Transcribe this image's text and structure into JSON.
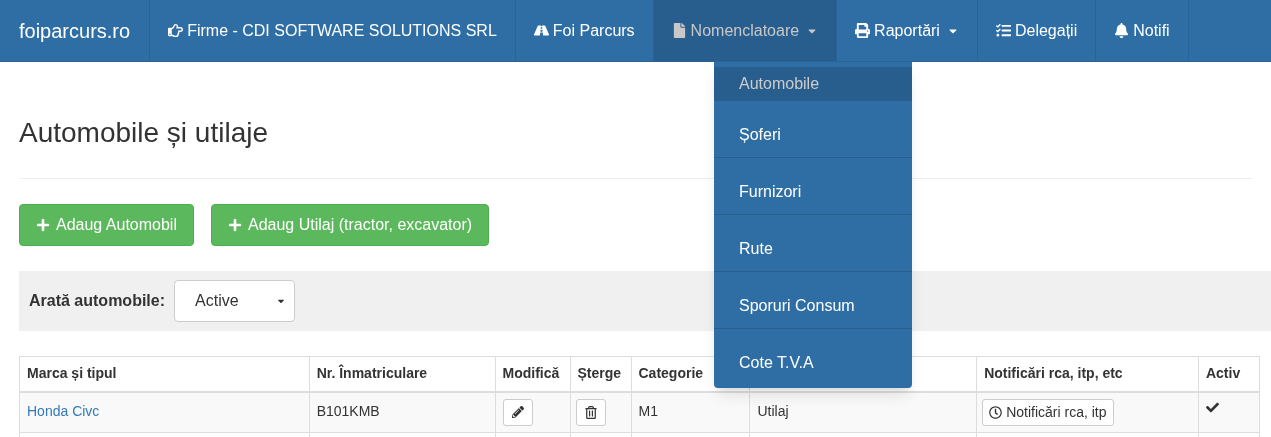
{
  "navbar": {
    "brand": "foiparcurs.ro",
    "items": [
      {
        "label": "Firme - CDI SOFTWARE SOLUTIONS SRL",
        "caret": false,
        "open": false
      },
      {
        "label": "Foi Parcurs",
        "caret": false,
        "open": false
      },
      {
        "label": "Nomenclatoare",
        "caret": true,
        "open": true
      },
      {
        "label": "Raportări",
        "caret": true,
        "open": false
      },
      {
        "label": "Delegații",
        "caret": false,
        "open": false
      },
      {
        "label": "Notifi",
        "caret": false,
        "open": false
      }
    ]
  },
  "dropdown": {
    "items": [
      {
        "label": "Automobile",
        "selected": true
      },
      {
        "label": "Șoferi",
        "selected": false
      },
      {
        "label": "Furnizori",
        "selected": false
      },
      {
        "label": "Rute",
        "selected": false
      },
      {
        "label": "Sporuri Consum",
        "selected": false
      },
      {
        "label": "Cote T.V.A",
        "selected": false
      }
    ]
  },
  "page_title": "Automobile și utilaje",
  "add_buttons": [
    "Adaug Automobil",
    "Adaug Utilaj (tractor, excavator)"
  ],
  "filter": {
    "label": "Arată automobile:",
    "value": "Active"
  },
  "table": {
    "columns": [
      "Marca și tipul",
      "Nr. Înmatriculare",
      "Modifică",
      "Șterge",
      "Categorie",
      "",
      "Notificări rca, itp, etc",
      "Activ"
    ],
    "rows": [
      {
        "name": "Honda Civc",
        "plate": "B101KMB",
        "category": "M1",
        "type": "Utilaj",
        "notify": "Notificări rca, itp",
        "active": true
      }
    ]
  }
}
